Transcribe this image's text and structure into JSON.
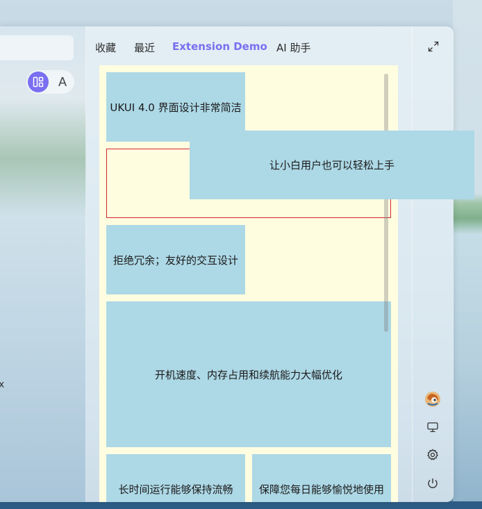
{
  "menu": {
    "view_toggle_letter": "A",
    "edge_char": "x",
    "tabs": [
      {
        "label": "收藏"
      },
      {
        "label": "最近"
      },
      {
        "label": "Extension Demo"
      },
      {
        "label": "AI 助手"
      }
    ],
    "active_tab_color": "#7a6ff0"
  },
  "demo": {
    "card_color": "#add8e6",
    "background_color": "#fffde0",
    "outline_color": "#d2262a",
    "cards": [
      {
        "label": "UKUI 4.0 界面设计非常简洁"
      },
      {
        "label": "让小白用户也可以轻松上手"
      },
      {
        "label": "拒绝冗余；友好的交互设计"
      },
      {
        "label": "开机速度、内存占用和续航能力大幅优化"
      },
      {
        "label": "长时间运行能够保持流畅"
      },
      {
        "label": "保障您每日能够愉悦地使用"
      }
    ]
  },
  "side_icons": [
    "expand-icon",
    "user-avatar",
    "display-icon",
    "settings-icon",
    "power-icon"
  ]
}
